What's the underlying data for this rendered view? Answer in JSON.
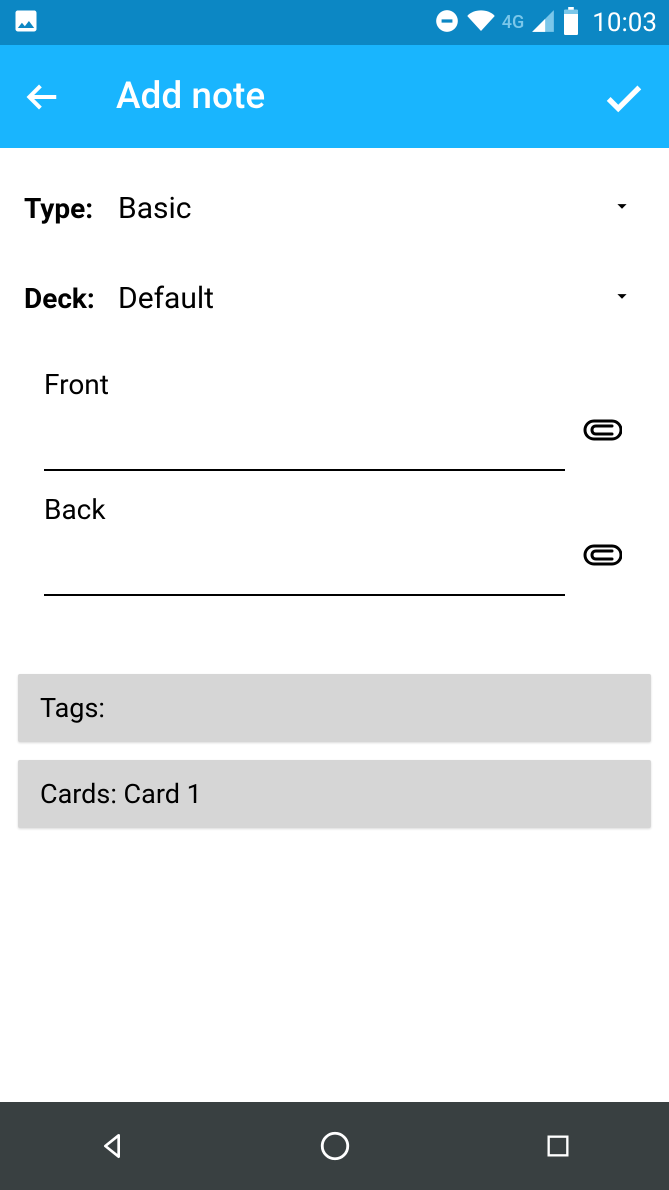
{
  "status": {
    "time": "10:03",
    "network": "4G"
  },
  "appbar": {
    "title": "Add note"
  },
  "selectors": {
    "type_label": "Type:",
    "type_value": "Basic",
    "deck_label": "Deck:",
    "deck_value": "Default"
  },
  "fields": {
    "front_label": "Front",
    "front_value": "",
    "back_label": "Back",
    "back_value": ""
  },
  "rows": {
    "tags": "Tags: ",
    "cards": "Cards: Card 1"
  }
}
